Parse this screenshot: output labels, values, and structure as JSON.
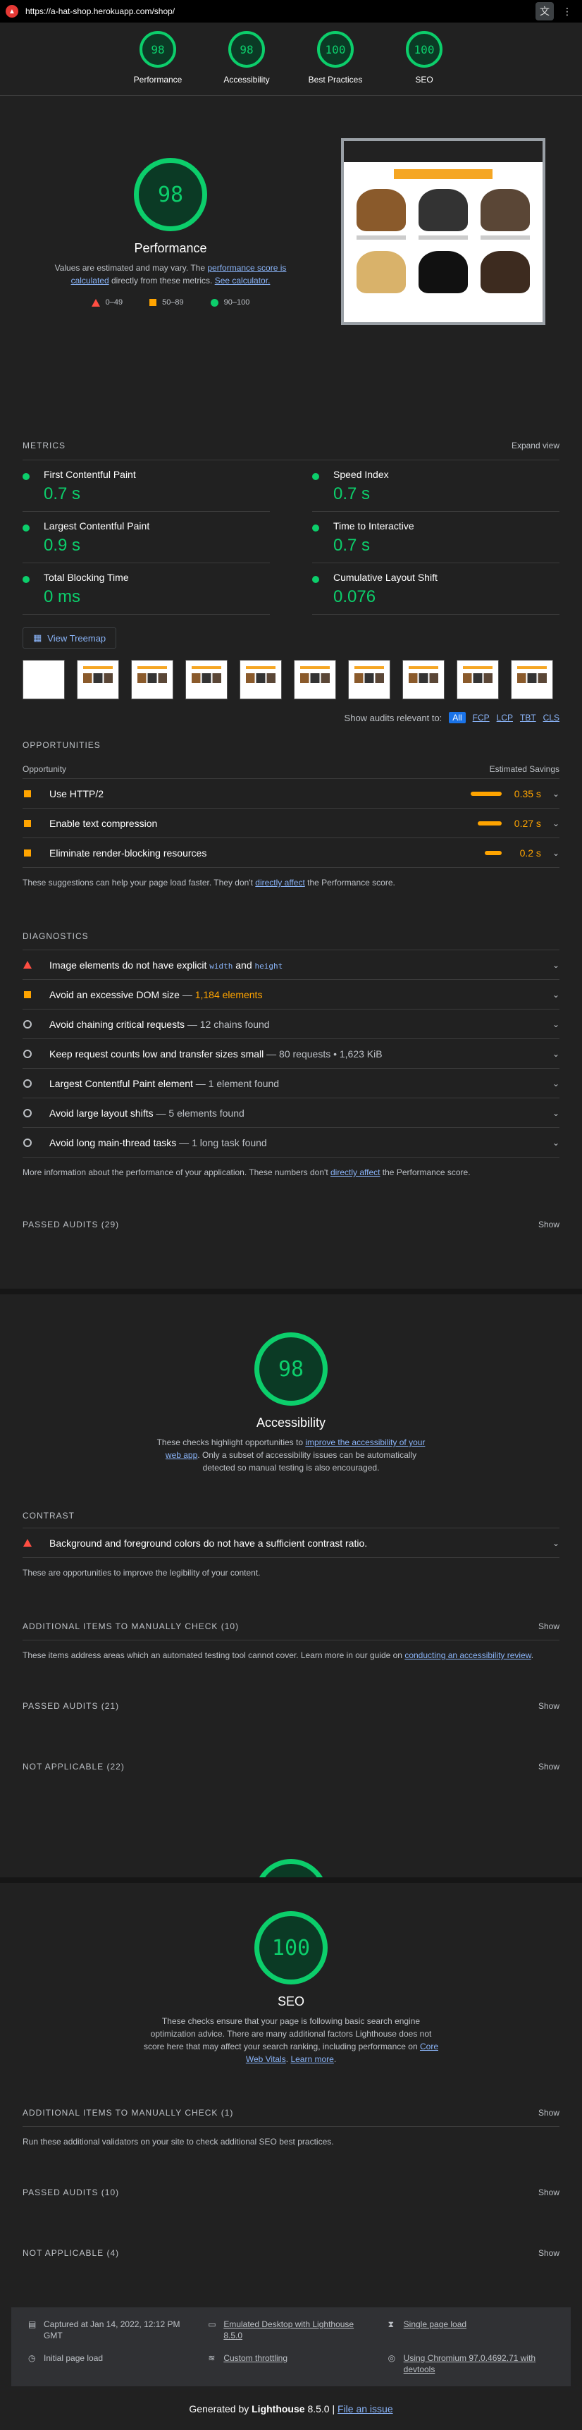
{
  "browser": {
    "url": "https://a-hat-shop.herokuapp.com/shop/"
  },
  "gauges": [
    {
      "score": "98",
      "label": "Performance"
    },
    {
      "score": "98",
      "label": "Accessibility"
    },
    {
      "score": "100",
      "label": "Best Practices"
    },
    {
      "score": "100",
      "label": "SEO"
    }
  ],
  "performance": {
    "score": "98",
    "title": "Performance",
    "desc_pre": "Values are estimated and may vary. The ",
    "desc_link1": "performance score is calculated",
    "desc_mid": " directly from these metrics. ",
    "desc_link2": "See calculator.",
    "legend": {
      "fail": "0–49",
      "average": "50–89",
      "pass": "90–100"
    },
    "metrics_label": "METRICS",
    "expand_view": "Expand view",
    "metrics": [
      {
        "name": "First Contentful Paint",
        "value": "0.7 s"
      },
      {
        "name": "Speed Index",
        "value": "0.7 s"
      },
      {
        "name": "Largest Contentful Paint",
        "value": "0.9 s"
      },
      {
        "name": "Time to Interactive",
        "value": "0.7 s"
      },
      {
        "name": "Total Blocking Time",
        "value": "0 ms"
      },
      {
        "name": "Cumulative Layout Shift",
        "value": "0.076"
      }
    ],
    "treemap": "View Treemap",
    "relevant_label": "Show audits relevant to:",
    "relevant": [
      "All",
      "FCP",
      "LCP",
      "TBT",
      "CLS"
    ],
    "opportunities_title": "OPPORTUNITIES",
    "opportunity_col": "Opportunity",
    "savings_col": "Estimated Savings",
    "opportunities": [
      {
        "title": "Use HTTP/2",
        "savings": "0.35 s"
      },
      {
        "title": "Enable text compression",
        "savings": "0.27 s"
      },
      {
        "title": "Eliminate render-blocking resources",
        "savings": "0.2 s"
      }
    ],
    "opp_note_pre": "These suggestions can help your page load faster. They don't ",
    "opp_note_link": "directly affect",
    "opp_note_post": " the Performance score.",
    "diagnostics_title": "DIAGNOSTICS",
    "diag": {
      "img_pre": "Image elements do not have explicit ",
      "img_code1": "width",
      "img_and": " and ",
      "img_code2": "height",
      "dom_title": "Avoid an excessive DOM size",
      "dom_sep": " — ",
      "dom_value": "1,184 elements",
      "chain_title": "Avoid chaining critical requests",
      "chain_sub": " — 12 chains found",
      "req_title": "Keep request counts low and transfer sizes small",
      "req_sub": " — 80 requests • 1,623 KiB",
      "lcp_title": "Largest Contentful Paint element",
      "lcp_sub": " — 1 element found",
      "shift_title": "Avoid large layout shifts",
      "shift_sub": " — 5 elements found",
      "thread_title": "Avoid long main-thread tasks",
      "thread_sub": " — 1 long task found"
    },
    "diag_note_pre": "More information about the performance of your application. These numbers don't ",
    "diag_note_link": "directly affect",
    "diag_note_post": " the Performance score.",
    "passed": "PASSED AUDITS (29)",
    "show": "Show"
  },
  "accessibility": {
    "score": "98",
    "title": "Accessibility",
    "desc_pre": "These checks highlight opportunities to ",
    "desc_link": "improve the accessibility of your web app",
    "desc_post": ". Only a subset of accessibility issues can be automatically detected so manual testing is also encouraged.",
    "contrast_title": "CONTRAST",
    "contrast_audit": "Background and foreground colors do not have a sufficient contrast ratio.",
    "contrast_note": "These are opportunities to improve the legibility of your content.",
    "manual_title": "ADDITIONAL ITEMS TO MANUALLY CHECK (10)",
    "manual_note_pre": "These items address areas which an automated testing tool cannot cover. Learn more in our guide on ",
    "manual_note_link": "conducting an accessibility review",
    "manual_note_post": ".",
    "passed": "PASSED AUDITS (21)",
    "na": "NOT APPLICABLE (22)",
    "show": "Show"
  },
  "seo": {
    "score": "100",
    "title": "SEO",
    "desc_pre": "These checks ensure that your page is following basic search engine optimization advice. There are many additional factors Lighthouse does not score here that may affect your search ranking, including performance on ",
    "desc_link1": "Core Web Vitals",
    "desc_mid": ". ",
    "desc_link2": "Learn more",
    "desc_post": ".",
    "manual_title": "ADDITIONAL ITEMS TO MANUALLY CHECK (1)",
    "manual_note": "Run these additional validators on your site to check additional SEO best practices.",
    "passed": "PASSED AUDITS (10)",
    "na": "NOT APPLICABLE (4)",
    "show": "Show"
  },
  "footer": {
    "captured": "Captured at Jan 14, 2022, 12:12 PM GMT",
    "emulated": "Emulated Desktop with Lighthouse 8.5.0",
    "single": "Single page load",
    "initial": "Initial page load",
    "throttling": "Custom throttling",
    "chromium": "Using Chromium 97.0.4692.71 with devtools",
    "gen_pre": "Generated by ",
    "gen_brand": "Lighthouse",
    "gen_ver": " 8.5.0 | ",
    "gen_link": "File an issue"
  }
}
